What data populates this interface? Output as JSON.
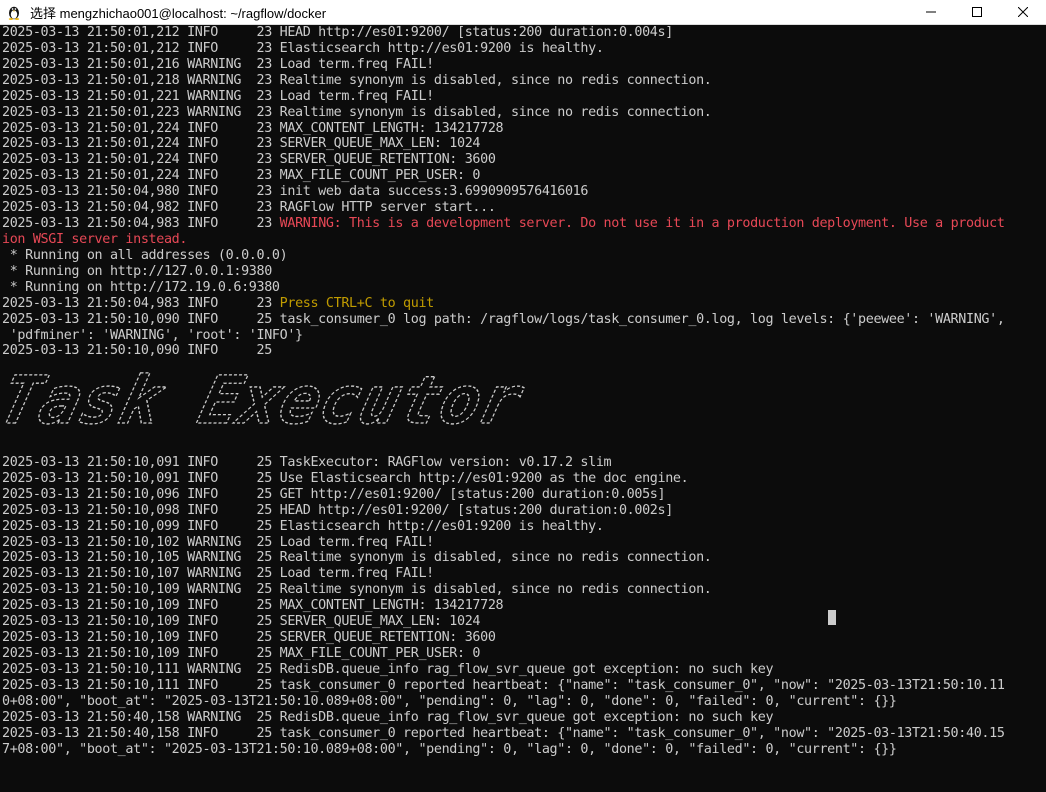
{
  "window": {
    "title": "选择 mengzhichao001@localhost: ~/ragflow/docker",
    "icon": "linux-penguin-icon",
    "controls": [
      "minimize-icon",
      "maximize-icon",
      "close-icon"
    ]
  },
  "terminal": {
    "banner_text": "Task Executor",
    "colors": {
      "text": "#cccccc",
      "warning": "#e74856",
      "highlight": "#c19c00",
      "background": "#0c0c0c"
    },
    "lines_before": [
      {
        "t": "2025-03-13 21:50:01,212 INFO     23 HEAD http://es01:9200/ [status:200 duration:0.004s]"
      },
      {
        "t": "2025-03-13 21:50:01,212 INFO     23 Elasticsearch http://es01:9200 is healthy."
      },
      {
        "t": "2025-03-13 21:50:01,216 WARNING  23 Load term.freq FAIL!"
      },
      {
        "t": "2025-03-13 21:50:01,218 WARNING  23 Realtime synonym is disabled, since no redis connection."
      },
      {
        "t": "2025-03-13 21:50:01,221 WARNING  23 Load term.freq FAIL!"
      },
      {
        "t": "2025-03-13 21:50:01,223 WARNING  23 Realtime synonym is disabled, since no redis connection."
      },
      {
        "t": "2025-03-13 21:50:01,224 INFO     23 MAX_CONTENT_LENGTH: 134217728"
      },
      {
        "t": "2025-03-13 21:50:01,224 INFO     23 SERVER_QUEUE_MAX_LEN: 1024"
      },
      {
        "t": "2025-03-13 21:50:01,224 INFO     23 SERVER_QUEUE_RETENTION: 3600"
      },
      {
        "t": "2025-03-13 21:50:01,224 INFO     23 MAX_FILE_COUNT_PER_USER: 0"
      },
      {
        "t": "2025-03-13 21:50:04,980 INFO     23 init web data success:3.6990909576416016"
      },
      {
        "t": "2025-03-13 21:50:04,982 INFO     23 RAGFlow HTTP server start..."
      },
      {
        "t": "2025-03-13 21:50:04,983 INFO     23 ",
        "w": "WARNING: This is a development server. Do not use it in a production deployment. Use a product"
      },
      {
        "t": "",
        "w": "ion WSGI server instead."
      },
      {
        "t": " * Running on all addresses (0.0.0.0)"
      },
      {
        "t": " * Running on http://127.0.0.1:9380"
      },
      {
        "t": " * Running on http://172.19.0.6:9380"
      },
      {
        "t": "2025-03-13 21:50:04,983 INFO     23 ",
        "y": "Press CTRL+C to quit"
      },
      {
        "t": "2025-03-13 21:50:10,090 INFO     25 task_consumer_0 log path: /ragflow/logs/task_consumer_0.log, log levels: {'peewee': 'WARNING',"
      },
      {
        "t": " 'pdfminer': 'WARNING', 'root': 'INFO'}"
      },
      {
        "t": "2025-03-13 21:50:10,090 INFO     25"
      }
    ],
    "lines_after": [
      {
        "t": "2025-03-13 21:50:10,091 INFO     25 TaskExecutor: RAGFlow version: v0.17.2 slim"
      },
      {
        "t": "2025-03-13 21:50:10,091 INFO     25 Use Elasticsearch http://es01:9200 as the doc engine."
      },
      {
        "t": "2025-03-13 21:50:10,096 INFO     25 GET http://es01:9200/ [status:200 duration:0.005s]"
      },
      {
        "t": "2025-03-13 21:50:10,098 INFO     25 HEAD http://es01:9200/ [status:200 duration:0.002s]"
      },
      {
        "t": "2025-03-13 21:50:10,099 INFO     25 Elasticsearch http://es01:9200 is healthy."
      },
      {
        "t": "2025-03-13 21:50:10,102 WARNING  25 Load term.freq FAIL!"
      },
      {
        "t": "2025-03-13 21:50:10,105 WARNING  25 Realtime synonym is disabled, since no redis connection."
      },
      {
        "t": "2025-03-13 21:50:10,107 WARNING  25 Load term.freq FAIL!"
      },
      {
        "t": "2025-03-13 21:50:10,109 WARNING  25 Realtime synonym is disabled, since no redis connection."
      },
      {
        "t": "2025-03-13 21:50:10,109 INFO     25 MAX_CONTENT_LENGTH: 134217728"
      },
      {
        "t": "2025-03-13 21:50:10,109 INFO     25 SERVER_QUEUE_MAX_LEN: 1024"
      },
      {
        "t": "2025-03-13 21:50:10,109 INFO     25 SERVER_QUEUE_RETENTION: 3600"
      },
      {
        "t": "2025-03-13 21:50:10,109 INFO     25 MAX_FILE_COUNT_PER_USER: 0"
      },
      {
        "t": "2025-03-13 21:50:10,111 WARNING  25 RedisDB.queue_info rag_flow_svr_queue got exception: no such key"
      },
      {
        "t": "2025-03-13 21:50:10,111 INFO     25 task_consumer_0 reported heartbeat: {\"name\": \"task_consumer_0\", \"now\": \"2025-03-13T21:50:10.11"
      },
      {
        "t": "0+08:00\", \"boot_at\": \"2025-03-13T21:50:10.089+08:00\", \"pending\": 0, \"lag\": 0, \"done\": 0, \"failed\": 0, \"current\": {}}"
      },
      {
        "t": "2025-03-13 21:50:40,158 WARNING  25 RedisDB.queue_info rag_flow_svr_queue got exception: no such key"
      },
      {
        "t": "2025-03-13 21:50:40,158 INFO     25 task_consumer_0 reported heartbeat: {\"name\": \"task_consumer_0\", \"now\": \"2025-03-13T21:50:40.15"
      },
      {
        "t": "7+08:00\", \"boot_at\": \"2025-03-13T21:50:10.089+08:00\", \"pending\": 0, \"lag\": 0, \"done\": 0, \"failed\": 0, \"current\": {}}"
      }
    ]
  }
}
